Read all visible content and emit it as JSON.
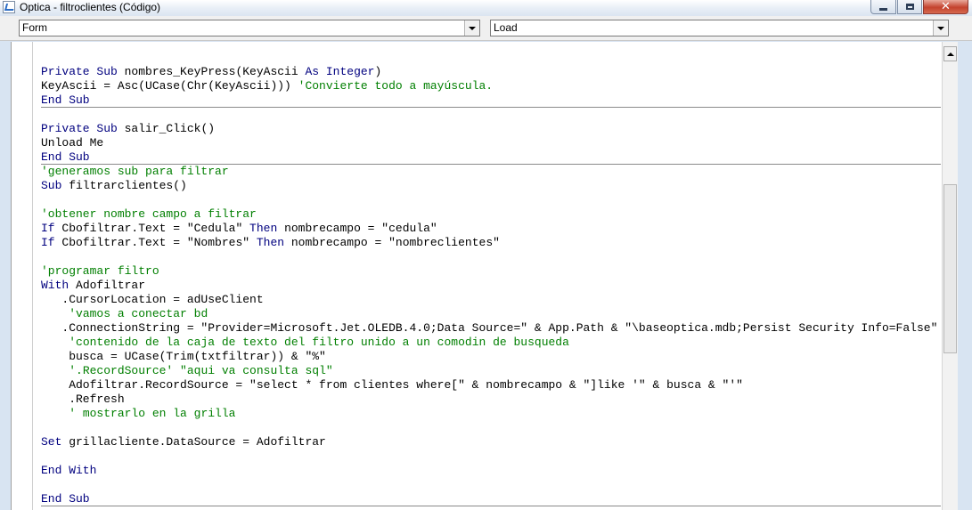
{
  "window": {
    "title": "Optica - filtroclientes (Código)",
    "buttons": {
      "minimize": "minimize",
      "maximize": "maximize",
      "close": "✕"
    }
  },
  "combos": {
    "object": {
      "value": "Form"
    },
    "procedure": {
      "value": "Load"
    }
  },
  "code_lines": [
    {
      "separator": false,
      "segments": [
        {
          "t": "",
          "c": "plain"
        }
      ]
    },
    {
      "separator": false,
      "segments": [
        {
          "t": "Private Sub",
          "c": "kw"
        },
        {
          "t": " nombres_KeyPress(KeyAscii ",
          "c": "plain"
        },
        {
          "t": "As Integer",
          "c": "kw"
        },
        {
          "t": ")",
          "c": "plain"
        }
      ]
    },
    {
      "separator": false,
      "segments": [
        {
          "t": "KeyAscii = Asc(UCase(Chr(KeyAscii))) ",
          "c": "plain"
        },
        {
          "t": "'Convierte todo a mayúscula.",
          "c": "cm"
        }
      ]
    },
    {
      "separator": true,
      "segments": [
        {
          "t": "End Sub",
          "c": "kw"
        }
      ]
    },
    {
      "separator": false,
      "segments": [
        {
          "t": "",
          "c": "plain"
        }
      ]
    },
    {
      "separator": false,
      "segments": [
        {
          "t": "Private Sub",
          "c": "kw"
        },
        {
          "t": " salir_Click()",
          "c": "plain"
        }
      ]
    },
    {
      "separator": false,
      "segments": [
        {
          "t": "Unload Me",
          "c": "plain"
        }
      ]
    },
    {
      "separator": true,
      "segments": [
        {
          "t": "End Sub",
          "c": "kw"
        }
      ]
    },
    {
      "separator": false,
      "segments": [
        {
          "t": "'generamos sub para filtrar",
          "c": "cm"
        }
      ]
    },
    {
      "separator": false,
      "segments": [
        {
          "t": "Sub",
          "c": "kw"
        },
        {
          "t": " filtrarclientes()",
          "c": "plain"
        }
      ]
    },
    {
      "separator": false,
      "segments": [
        {
          "t": "",
          "c": "plain"
        }
      ]
    },
    {
      "separator": false,
      "segments": [
        {
          "t": "'obtener nombre campo a filtrar",
          "c": "cm"
        }
      ]
    },
    {
      "separator": false,
      "segments": [
        {
          "t": "If",
          "c": "kw"
        },
        {
          "t": " Cbofiltrar.Text = \"Cedula\" ",
          "c": "plain"
        },
        {
          "t": "Then",
          "c": "kw"
        },
        {
          "t": " nombrecampo = \"cedula\"",
          "c": "plain"
        }
      ]
    },
    {
      "separator": false,
      "segments": [
        {
          "t": "If",
          "c": "kw"
        },
        {
          "t": " Cbofiltrar.Text = \"Nombres\" ",
          "c": "plain"
        },
        {
          "t": "Then",
          "c": "kw"
        },
        {
          "t": " nombrecampo = \"nombreclientes\"",
          "c": "plain"
        }
      ]
    },
    {
      "separator": false,
      "segments": [
        {
          "t": "",
          "c": "plain"
        }
      ]
    },
    {
      "separator": false,
      "segments": [
        {
          "t": "'programar filtro",
          "c": "cm"
        }
      ]
    },
    {
      "separator": false,
      "segments": [
        {
          "t": "With",
          "c": "kw"
        },
        {
          "t": " Adofiltrar",
          "c": "plain"
        }
      ]
    },
    {
      "separator": false,
      "segments": [
        {
          "t": "   .CursorLocation = adUseClient",
          "c": "plain"
        }
      ]
    },
    {
      "separator": false,
      "segments": [
        {
          "t": "    ",
          "c": "plain"
        },
        {
          "t": "'vamos a conectar bd",
          "c": "cm"
        }
      ]
    },
    {
      "separator": false,
      "segments": [
        {
          "t": "   .ConnectionString = \"Provider=Microsoft.Jet.OLEDB.4.0;Data Source=\" & App.Path & \"\\baseoptica.mdb;Persist Security Info=False\"",
          "c": "plain"
        }
      ]
    },
    {
      "separator": false,
      "segments": [
        {
          "t": "    ",
          "c": "plain"
        },
        {
          "t": "'contenido de la caja de texto del filtro unido a un comodin de busqueda",
          "c": "cm"
        }
      ]
    },
    {
      "separator": false,
      "segments": [
        {
          "t": "    busca = UCase(Trim(txtfiltrar)) & \"%\"",
          "c": "plain"
        }
      ]
    },
    {
      "separator": false,
      "segments": [
        {
          "t": "    ",
          "c": "plain"
        },
        {
          "t": "'.RecordSource' \"aqui va consulta sql\"",
          "c": "cm"
        }
      ]
    },
    {
      "separator": false,
      "segments": [
        {
          "t": "    Adofiltrar.RecordSource = \"select * from clientes where[\" & nombrecampo & \"]like '\" & busca & \"'\"",
          "c": "plain"
        }
      ]
    },
    {
      "separator": false,
      "segments": [
        {
          "t": "    .Refresh",
          "c": "plain"
        }
      ]
    },
    {
      "separator": false,
      "segments": [
        {
          "t": "    ",
          "c": "plain"
        },
        {
          "t": "' mostrarlo en la grilla",
          "c": "cm"
        }
      ]
    },
    {
      "separator": false,
      "segments": [
        {
          "t": "",
          "c": "plain"
        }
      ]
    },
    {
      "separator": false,
      "segments": [
        {
          "t": "Set",
          "c": "kw"
        },
        {
          "t": " grillacliente.DataSource = Adofiltrar",
          "c": "plain"
        }
      ]
    },
    {
      "separator": false,
      "segments": [
        {
          "t": "",
          "c": "plain"
        }
      ]
    },
    {
      "separator": false,
      "segments": [
        {
          "t": "End With",
          "c": "kw"
        }
      ]
    },
    {
      "separator": false,
      "segments": [
        {
          "t": "",
          "c": "plain"
        }
      ]
    },
    {
      "separator": true,
      "segments": [
        {
          "t": "End Sub",
          "c": "kw"
        }
      ]
    }
  ],
  "colors": {
    "keyword": "#00007f",
    "comment": "#007f00",
    "text": "#000000"
  }
}
